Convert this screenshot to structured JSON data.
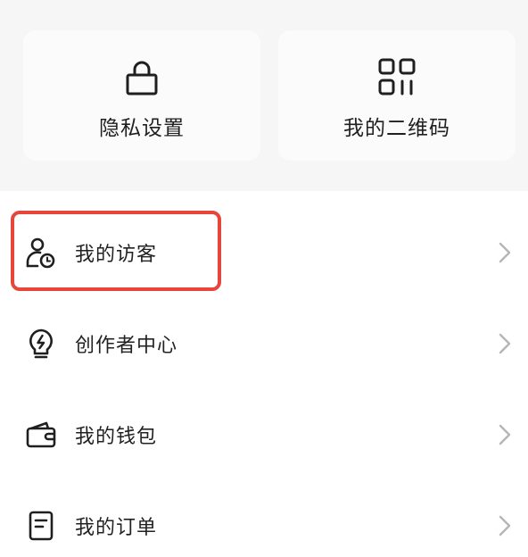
{
  "cards": [
    {
      "label": "隐私设置",
      "icon": "lock-icon"
    },
    {
      "label": "我的二维码",
      "icon": "qr-code-icon"
    }
  ],
  "menu": {
    "items": [
      {
        "label": "我的访客",
        "icon": "visitor-icon"
      },
      {
        "label": "创作者中心",
        "icon": "lightbulb-icon"
      },
      {
        "label": "我的钱包",
        "icon": "wallet-icon"
      },
      {
        "label": "我的订单",
        "icon": "order-document-icon"
      }
    ]
  },
  "colors": {
    "highlight": "#e8463a",
    "card_bg": "#fbfbfb",
    "section_bg": "#f6f6f6",
    "menu_bg": "#ffffff",
    "chevron": "#b5b5b5"
  }
}
